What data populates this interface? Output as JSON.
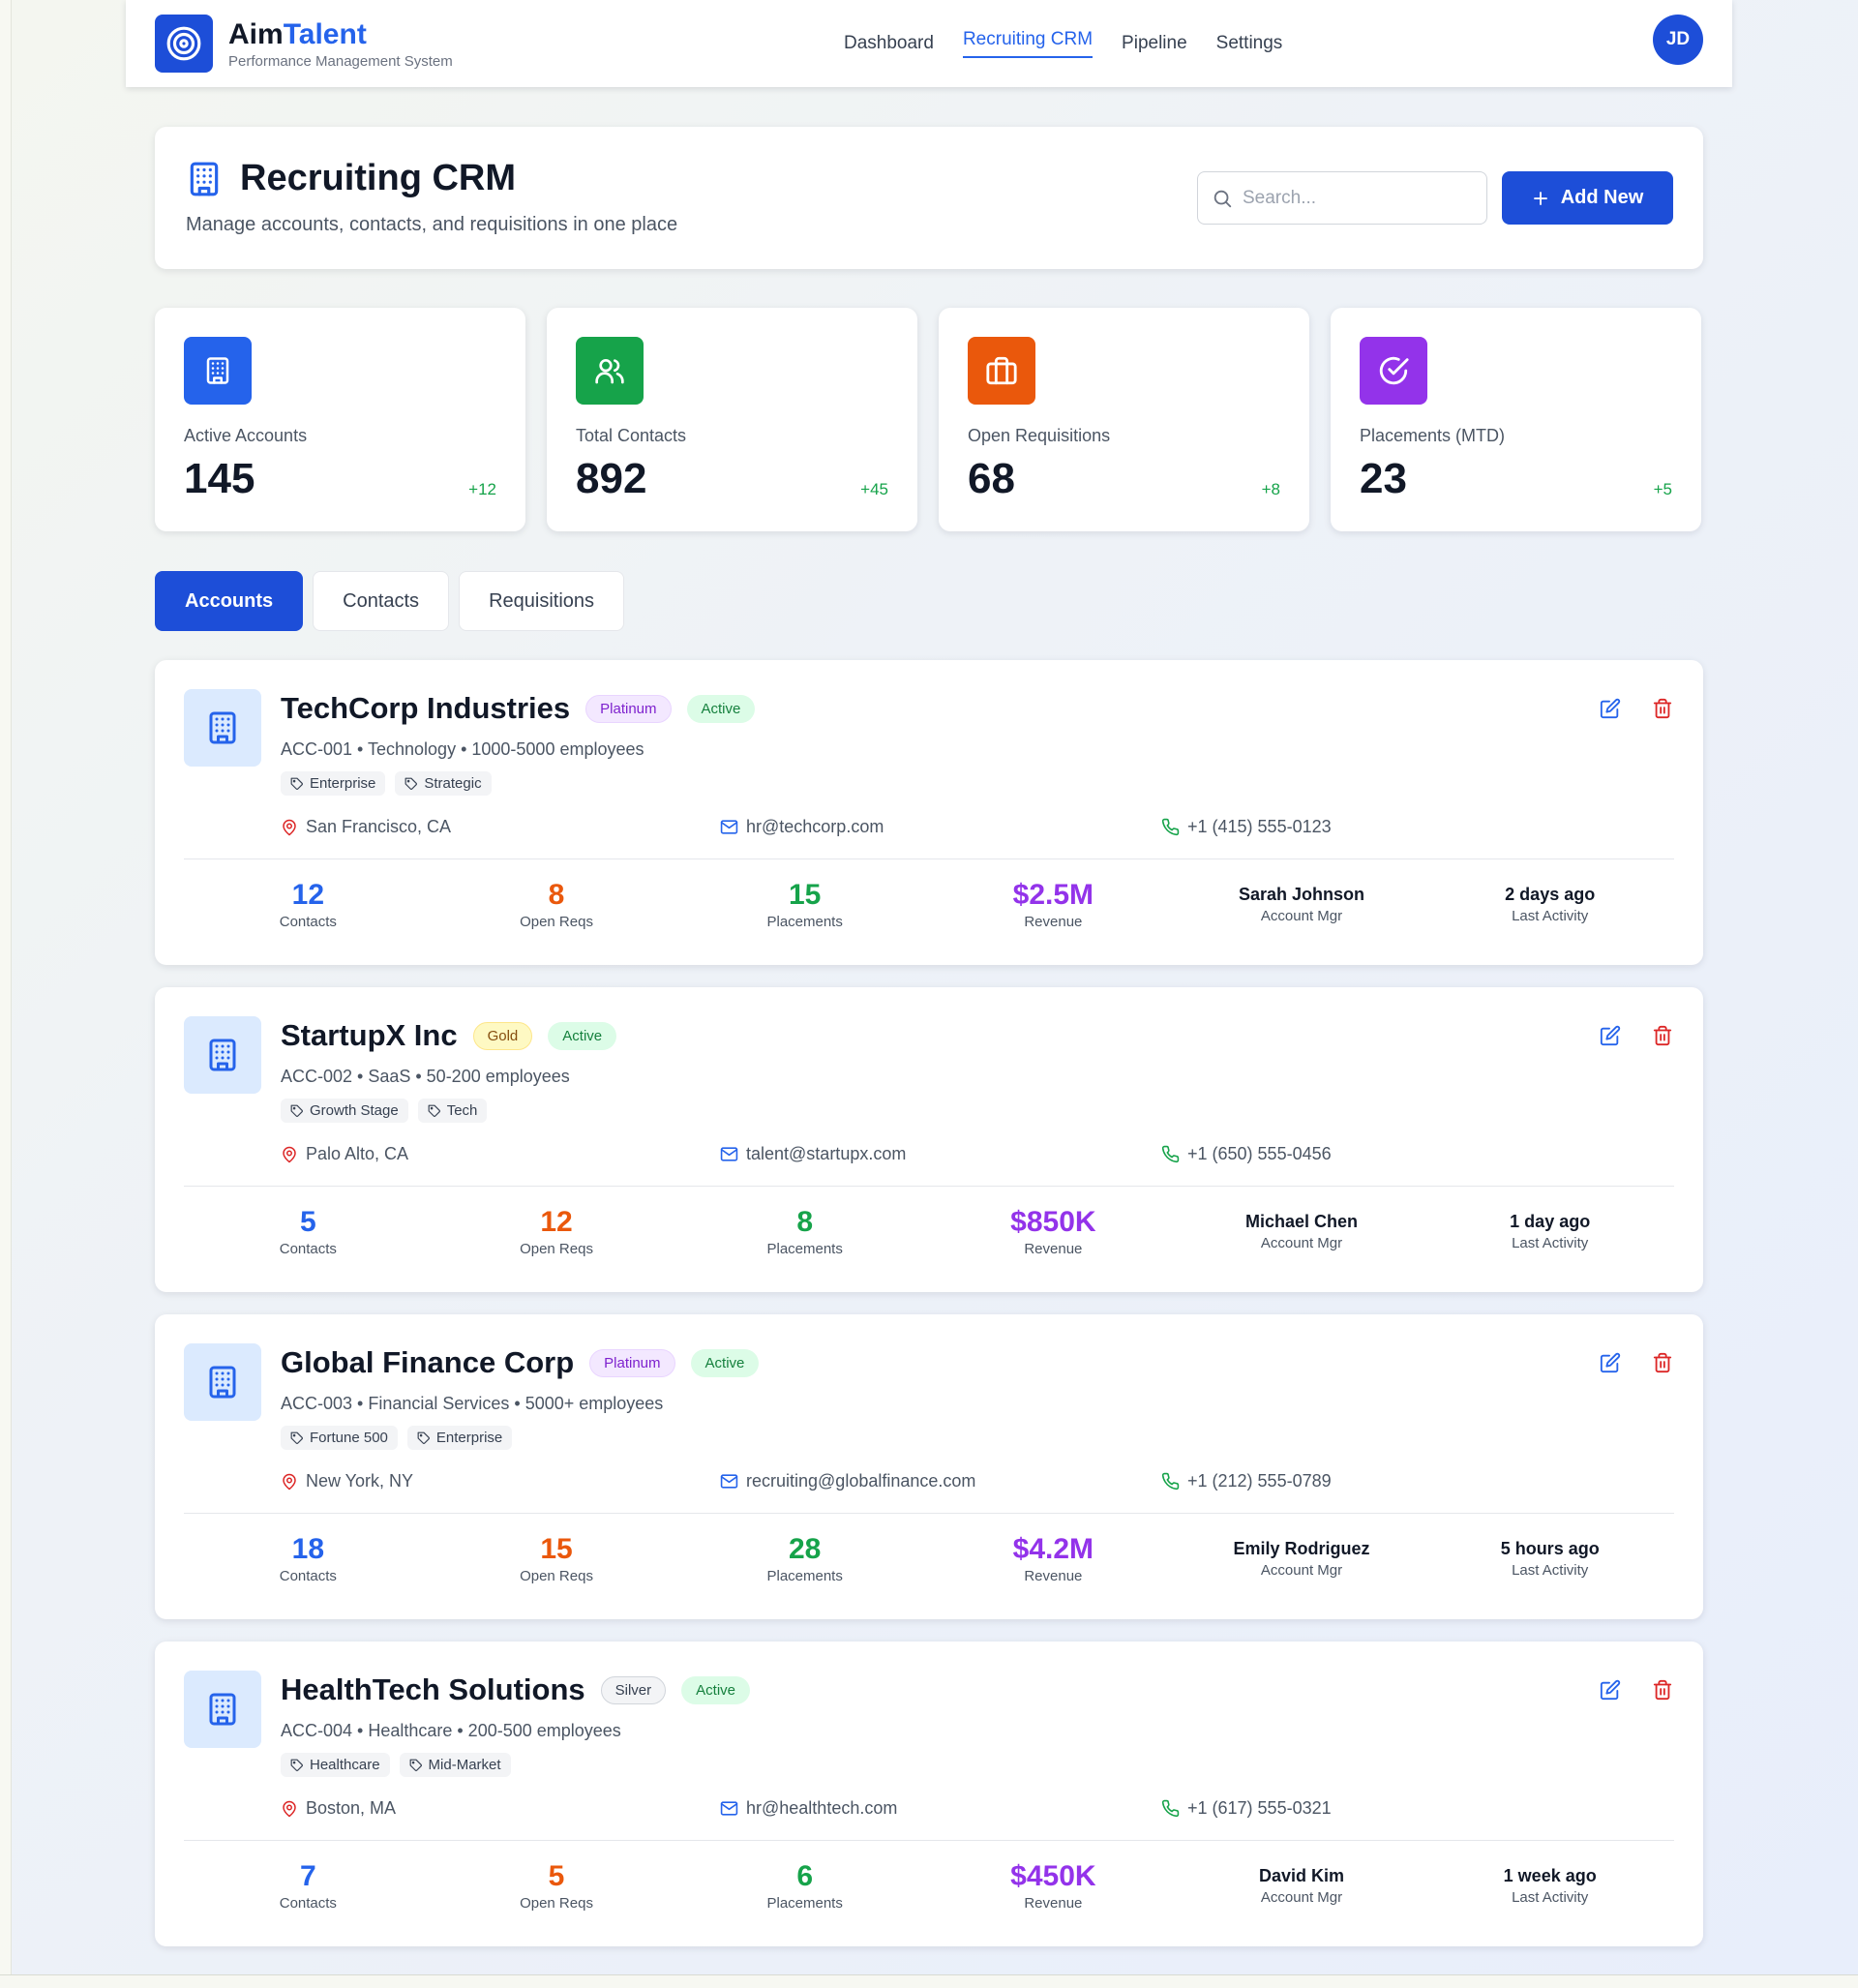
{
  "app": {
    "brand_prefix": "Aim",
    "brand_accent": "Talent",
    "subtitle": "Performance Management System",
    "avatar_initials": "JD",
    "accent_color": "#1d4ed8"
  },
  "nav": {
    "items": [
      {
        "label": "Dashboard",
        "active": false
      },
      {
        "label": "Recruiting CRM",
        "active": true
      },
      {
        "label": "Pipeline",
        "active": false
      },
      {
        "label": "Settings",
        "active": false
      }
    ]
  },
  "page": {
    "title": "Recruiting CRM",
    "subtitle": "Manage accounts, contacts, and requisitions in one place",
    "search_placeholder": "Search...",
    "add_label": "Add New"
  },
  "stats": [
    {
      "label": "Active Accounts",
      "value": "145",
      "delta": "+12",
      "icon": "building-icon",
      "color": "#2563eb"
    },
    {
      "label": "Total Contacts",
      "value": "892",
      "delta": "+45",
      "icon": "users-icon",
      "color": "#16a34a"
    },
    {
      "label": "Open Requisitions",
      "value": "68",
      "delta": "+8",
      "icon": "briefcase-icon",
      "color": "#ea580c"
    },
    {
      "label": "Placements (MTD)",
      "value": "23",
      "delta": "+5",
      "icon": "check-circle-icon",
      "color": "#9333ea"
    }
  ],
  "tabs": [
    {
      "label": "Accounts",
      "active": true
    },
    {
      "label": "Contacts",
      "active": false
    },
    {
      "label": "Requisitions",
      "active": false
    }
  ],
  "metric_labels": {
    "contacts": "Contacts",
    "open_reqs": "Open Reqs",
    "placements": "Placements",
    "revenue": "Revenue",
    "account_mgr": "Account Mgr",
    "last_activity": "Last Activity"
  },
  "accounts": [
    {
      "name": "TechCorp Industries",
      "tier": "Platinum",
      "status": "Active",
      "meta": "ACC-001 • Technology • 1000-5000 employees",
      "tags": [
        "Enterprise",
        "Strategic"
      ],
      "location": "San Francisco, CA",
      "email": "hr@techcorp.com",
      "phone": "+1 (415) 555-0123",
      "contacts": "12",
      "open_reqs": "8",
      "placements": "15",
      "revenue": "$2.5M",
      "account_mgr": "Sarah Johnson",
      "last_activity": "2 days ago"
    },
    {
      "name": "StartupX Inc",
      "tier": "Gold",
      "status": "Active",
      "meta": "ACC-002 • SaaS • 50-200 employees",
      "tags": [
        "Growth Stage",
        "Tech"
      ],
      "location": "Palo Alto, CA",
      "email": "talent@startupx.com",
      "phone": "+1 (650) 555-0456",
      "contacts": "5",
      "open_reqs": "12",
      "placements": "8",
      "revenue": "$850K",
      "account_mgr": "Michael Chen",
      "last_activity": "1 day ago"
    },
    {
      "name": "Global Finance Corp",
      "tier": "Platinum",
      "status": "Active",
      "meta": "ACC-003 • Financial Services • 5000+ employees",
      "tags": [
        "Fortune 500",
        "Enterprise"
      ],
      "location": "New York, NY",
      "email": "recruiting@globalfinance.com",
      "phone": "+1 (212) 555-0789",
      "contacts": "18",
      "open_reqs": "15",
      "placements": "28",
      "revenue": "$4.2M",
      "account_mgr": "Emily Rodriguez",
      "last_activity": "5 hours ago"
    },
    {
      "name": "HealthTech Solutions",
      "tier": "Silver",
      "status": "Active",
      "meta": "ACC-004 • Healthcare • 200-500 employees",
      "tags": [
        "Healthcare",
        "Mid-Market"
      ],
      "location": "Boston, MA",
      "email": "hr@healthtech.com",
      "phone": "+1 (617) 555-0321",
      "contacts": "7",
      "open_reqs": "5",
      "placements": "6",
      "revenue": "$450K",
      "account_mgr": "David Kim",
      "last_activity": "1 week ago"
    }
  ]
}
